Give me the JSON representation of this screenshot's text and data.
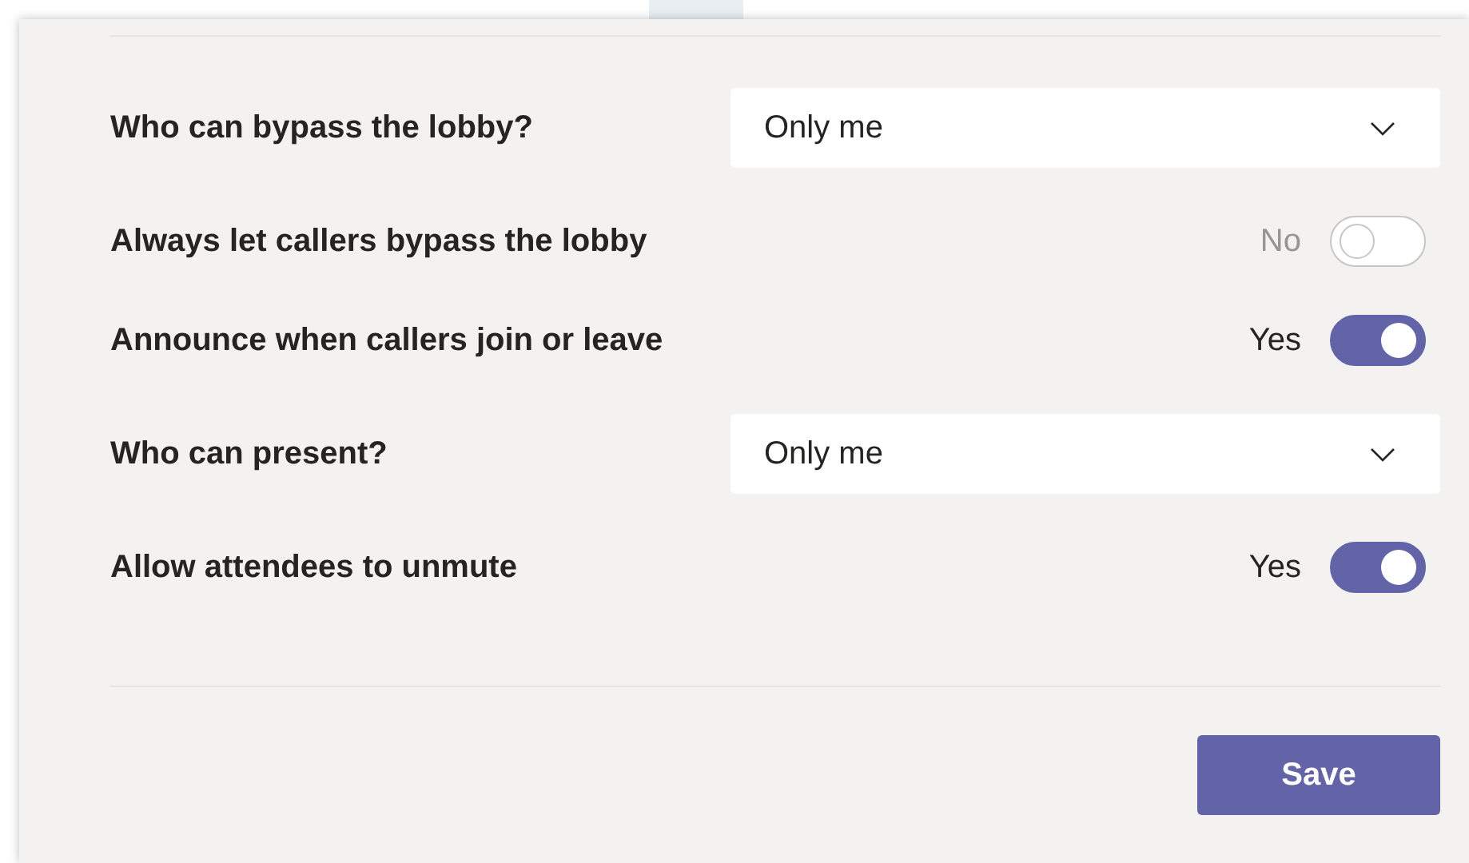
{
  "settings": [
    {
      "kind": "dropdown",
      "label": "Who can bypass the lobby?",
      "value": "Only me"
    },
    {
      "kind": "toggle",
      "label": "Always let callers bypass the lobby",
      "state_text": "No",
      "on": false,
      "disabled": true
    },
    {
      "kind": "toggle",
      "label": "Announce when callers join or leave",
      "state_text": "Yes",
      "on": true,
      "disabled": false
    },
    {
      "kind": "dropdown",
      "label": "Who can present?",
      "value": "Only me"
    },
    {
      "kind": "toggle",
      "label": "Allow attendees to unmute",
      "state_text": "Yes",
      "on": true,
      "disabled": false
    }
  ],
  "save_button": "Save"
}
